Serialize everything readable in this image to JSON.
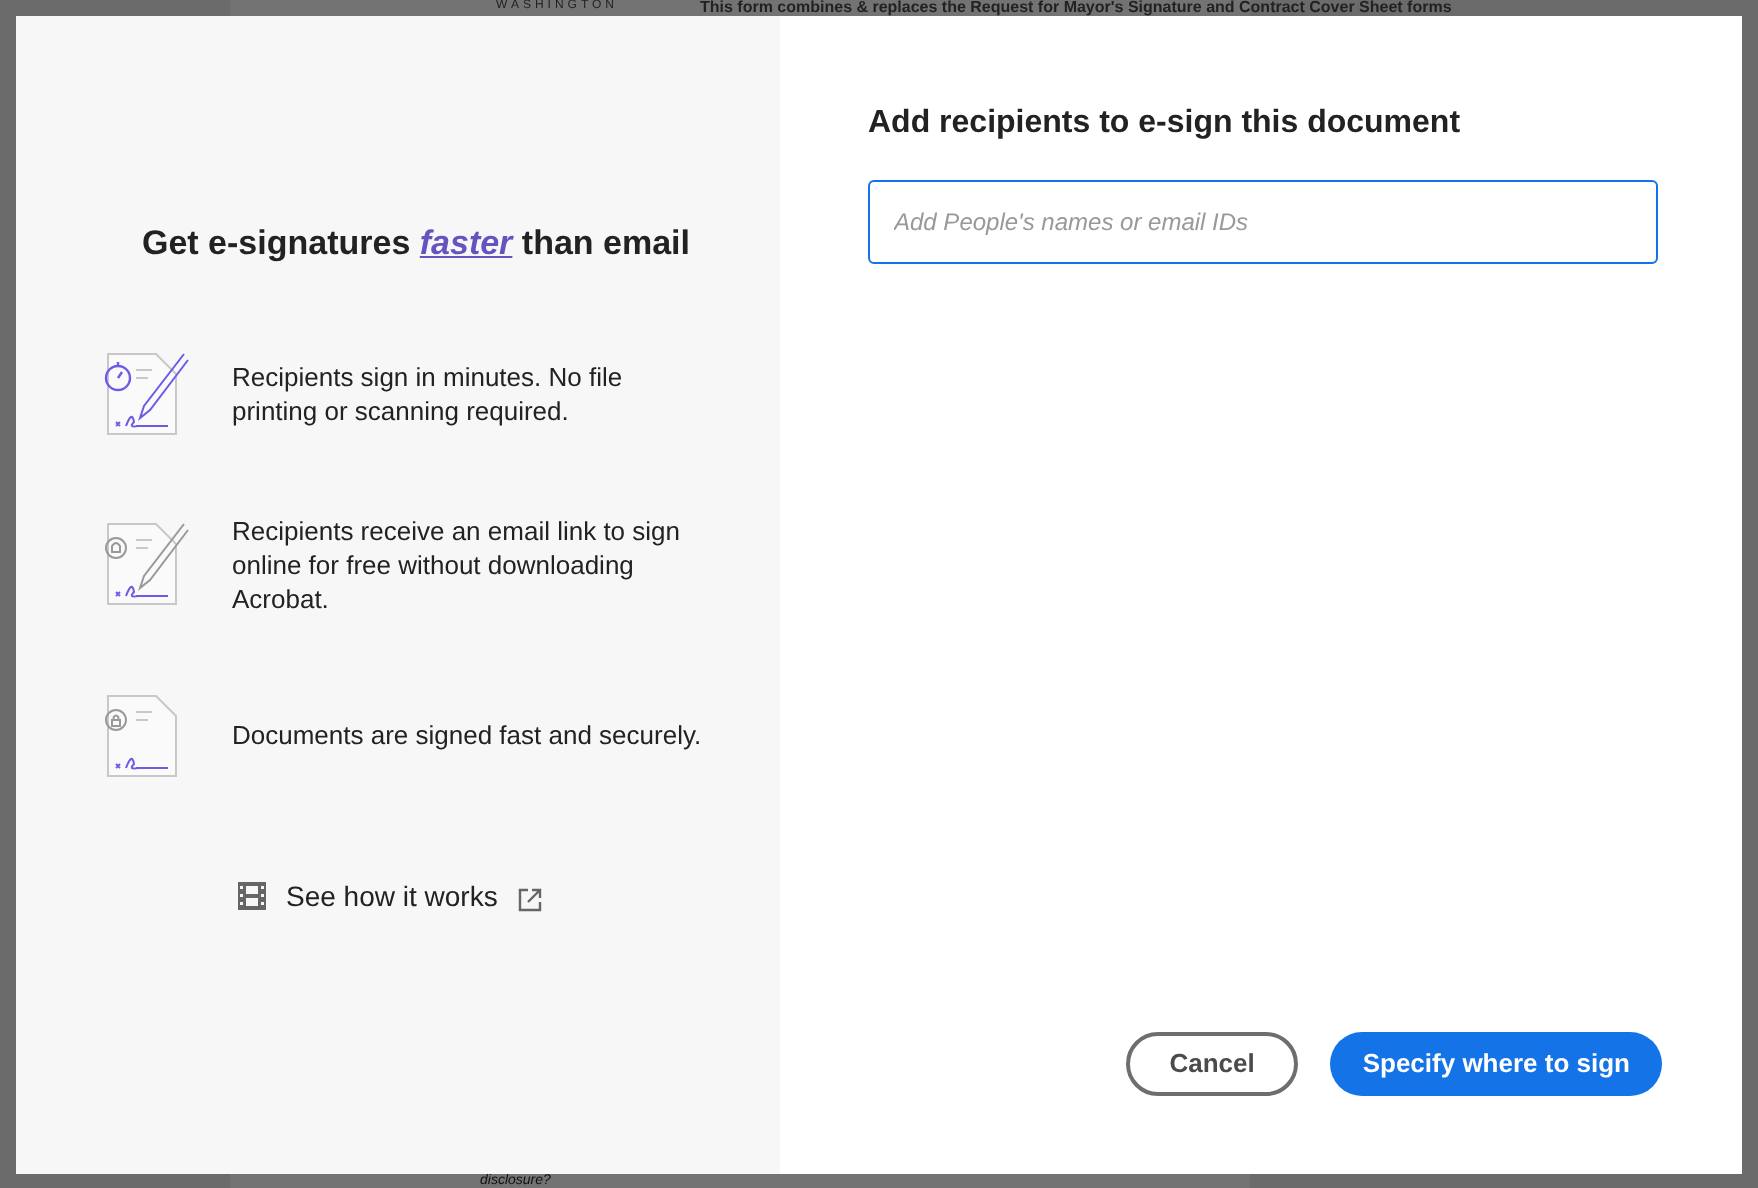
{
  "background": {
    "header_text": "WASHINGTON",
    "notice": "This form combines & replaces the Request for Mayor's Signature and Contract Cover Sheet forms",
    "footer_text": "disclosure?"
  },
  "promo": {
    "heading_before": "Get e-signatures",
    "heading_link": "faster",
    "heading_after": "than email",
    "features": [
      {
        "kind": "timer",
        "text": "Recipients sign in minutes. No file printing or scanning required."
      },
      {
        "kind": "bell",
        "text": "Recipients receive an email link to sign online for free without downloading Acrobat."
      },
      {
        "kind": "lock",
        "text": "Documents are signed fast and securely."
      }
    ],
    "video_link": "See how it works"
  },
  "recipients": {
    "title": "Add recipients to e-sign this document",
    "input": {
      "placeholder": "Add People's names or email IDs"
    }
  },
  "buttons": [
    {
      "kind": "secondary",
      "label": "Cancel"
    },
    {
      "kind": "primary",
      "label": "Specify where to sign"
    }
  ]
}
